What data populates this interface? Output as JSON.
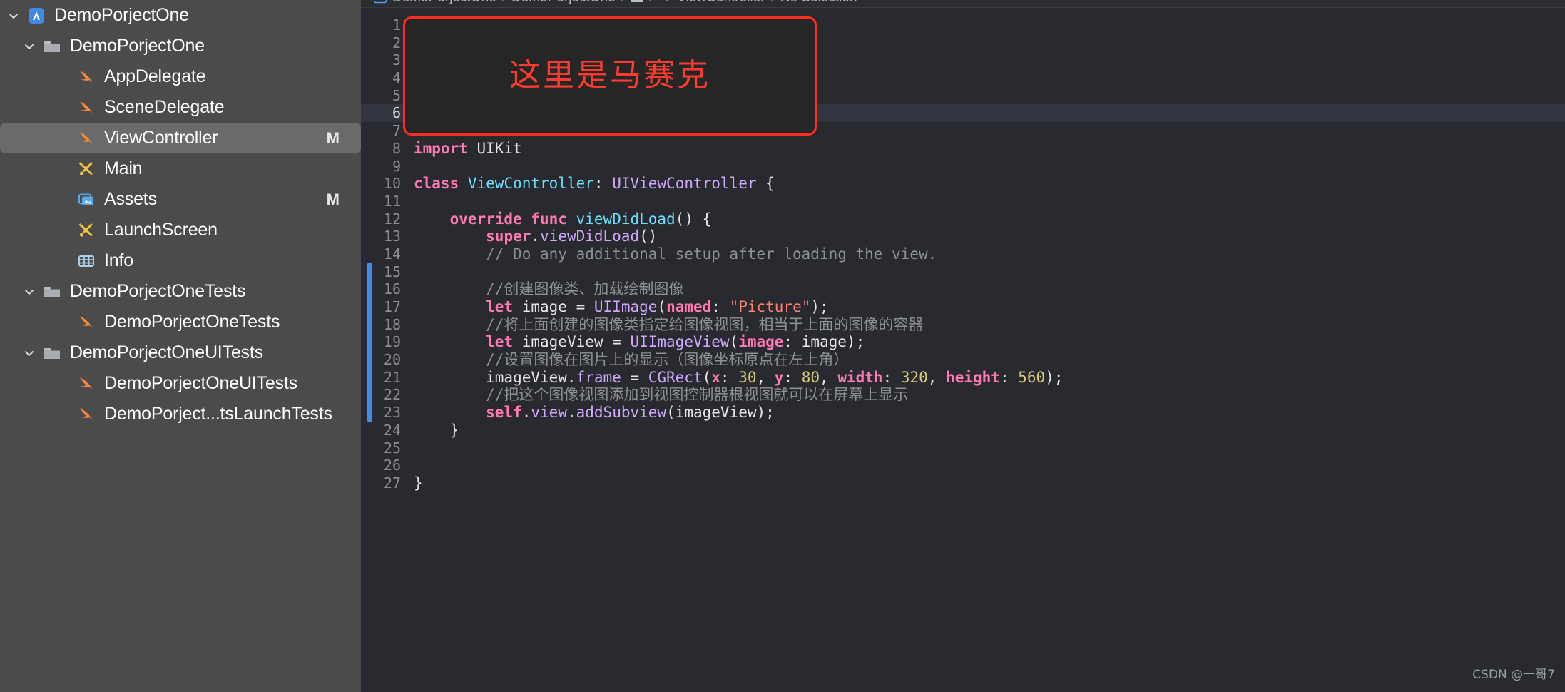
{
  "app": {
    "name": "Xcode",
    "watermark": "CSDN @一哥7"
  },
  "sidebar": {
    "items": [
      {
        "label": "DemoPorjectOne",
        "icon": "xcode-project-icon",
        "indent": 0,
        "twisty": "down",
        "badge": "",
        "selected": false
      },
      {
        "label": "DemoPorjectOne",
        "icon": "folder-icon",
        "indent": 1,
        "twisty": "down",
        "badge": "",
        "selected": false
      },
      {
        "label": "AppDelegate",
        "icon": "swift-file-icon",
        "indent": 2,
        "twisty": "",
        "badge": "",
        "selected": false
      },
      {
        "label": "SceneDelegate",
        "icon": "swift-file-icon",
        "indent": 2,
        "twisty": "",
        "badge": "",
        "selected": false
      },
      {
        "label": "ViewController",
        "icon": "swift-file-icon",
        "indent": 2,
        "twisty": "",
        "badge": "M",
        "selected": true
      },
      {
        "label": "Main",
        "icon": "storyboard-icon",
        "indent": 2,
        "twisty": "",
        "badge": "",
        "selected": false
      },
      {
        "label": "Assets",
        "icon": "assets-catalog-icon",
        "indent": 2,
        "twisty": "",
        "badge": "M",
        "selected": false
      },
      {
        "label": "LaunchScreen",
        "icon": "storyboard-icon",
        "indent": 2,
        "twisty": "",
        "badge": "",
        "selected": false
      },
      {
        "label": "Info",
        "icon": "plist-icon",
        "indent": 2,
        "twisty": "",
        "badge": "",
        "selected": false
      },
      {
        "label": "DemoPorjectOneTests",
        "icon": "folder-icon",
        "indent": 1,
        "twisty": "down",
        "badge": "",
        "selected": false
      },
      {
        "label": "DemoPorjectOneTests",
        "icon": "swift-file-icon",
        "indent": 2,
        "twisty": "",
        "badge": "",
        "selected": false
      },
      {
        "label": "DemoPorjectOneUITests",
        "icon": "folder-icon",
        "indent": 1,
        "twisty": "down",
        "badge": "",
        "selected": false
      },
      {
        "label": "DemoPorjectOneUITests",
        "icon": "swift-file-icon",
        "indent": 2,
        "twisty": "",
        "badge": "",
        "selected": false
      },
      {
        "label": "DemoPorject...tsLaunchTests",
        "icon": "swift-file-icon",
        "indent": 2,
        "twisty": "",
        "badge": "",
        "selected": false
      }
    ]
  },
  "breadcrumb": {
    "items": [
      "DemoPorjectOne",
      "DemoPorjectOne",
      "ViewController",
      "No Selection"
    ]
  },
  "redaction": {
    "text": "这里是马赛克",
    "border_color": "#ff2d1f",
    "text_color": "#ff3b2f"
  },
  "editor": {
    "current_line": 6,
    "change_bar_color": "#3c8fe8",
    "change_bar_from_line": 15,
    "change_bar_to_line": 23,
    "lines": [
      {
        "n": 1,
        "tokens": []
      },
      {
        "n": 2,
        "tokens": []
      },
      {
        "n": 3,
        "tokens": []
      },
      {
        "n": 4,
        "tokens": []
      },
      {
        "n": 5,
        "tokens": []
      },
      {
        "n": 6,
        "tokens": []
      },
      {
        "n": 7,
        "tokens": []
      },
      {
        "n": 8,
        "tokens": [
          {
            "t": "import",
            "c": "kw"
          },
          {
            "t": " UIKit",
            "c": "pln"
          }
        ]
      },
      {
        "n": 9,
        "tokens": []
      },
      {
        "n": 10,
        "tokens": [
          {
            "t": "class",
            "c": "kw"
          },
          {
            "t": " ",
            "c": "pln"
          },
          {
            "t": "ViewController",
            "c": "cls"
          },
          {
            "t": ": ",
            "c": "pln"
          },
          {
            "t": "UIViewController",
            "c": "type"
          },
          {
            "t": " {",
            "c": "pln"
          }
        ]
      },
      {
        "n": 11,
        "tokens": []
      },
      {
        "n": 12,
        "tokens": [
          {
            "t": "    ",
            "c": "pln"
          },
          {
            "t": "override",
            "c": "kw"
          },
          {
            "t": " ",
            "c": "pln"
          },
          {
            "t": "func",
            "c": "kw"
          },
          {
            "t": " ",
            "c": "pln"
          },
          {
            "t": "viewDidLoad",
            "c": "fn"
          },
          {
            "t": "() {",
            "c": "pln"
          }
        ]
      },
      {
        "n": 13,
        "tokens": [
          {
            "t": "        ",
            "c": "pln"
          },
          {
            "t": "super",
            "c": "kw"
          },
          {
            "t": ".",
            "c": "pln"
          },
          {
            "t": "viewDidLoad",
            "c": "prop"
          },
          {
            "t": "()",
            "c": "pln"
          }
        ]
      },
      {
        "n": 14,
        "tokens": [
          {
            "t": "        // Do any additional setup after loading the view.",
            "c": "cmt"
          }
        ]
      },
      {
        "n": 15,
        "tokens": []
      },
      {
        "n": 16,
        "tokens": [
          {
            "t": "        //创建图像类、加载绘制图像",
            "c": "cmt"
          }
        ]
      },
      {
        "n": 17,
        "tokens": [
          {
            "t": "        ",
            "c": "pln"
          },
          {
            "t": "let",
            "c": "kw"
          },
          {
            "t": " image = ",
            "c": "pln"
          },
          {
            "t": "UIImage",
            "c": "type"
          },
          {
            "t": "(",
            "c": "pln"
          },
          {
            "t": "named",
            "c": "kw"
          },
          {
            "t": ": ",
            "c": "pln"
          },
          {
            "t": "\"Picture\"",
            "c": "str"
          },
          {
            "t": ");",
            "c": "pln"
          }
        ]
      },
      {
        "n": 18,
        "tokens": [
          {
            "t": "        //将上面创建的图像类指定给图像视图，相当于上面的图像的容器",
            "c": "cmt"
          }
        ]
      },
      {
        "n": 19,
        "tokens": [
          {
            "t": "        ",
            "c": "pln"
          },
          {
            "t": "let",
            "c": "kw"
          },
          {
            "t": " imageView = ",
            "c": "pln"
          },
          {
            "t": "UIImageView",
            "c": "type"
          },
          {
            "t": "(",
            "c": "pln"
          },
          {
            "t": "image",
            "c": "kw"
          },
          {
            "t": ": image);",
            "c": "pln"
          }
        ]
      },
      {
        "n": 20,
        "tokens": [
          {
            "t": "        //设置图像在图片上的显示（图像坐标原点在左上角）",
            "c": "cmt"
          }
        ]
      },
      {
        "n": 21,
        "tokens": [
          {
            "t": "        imageView.",
            "c": "pln"
          },
          {
            "t": "frame",
            "c": "prop"
          },
          {
            "t": " = ",
            "c": "pln"
          },
          {
            "t": "CGRect",
            "c": "type"
          },
          {
            "t": "(",
            "c": "pln"
          },
          {
            "t": "x",
            "c": "kw"
          },
          {
            "t": ": ",
            "c": "pln"
          },
          {
            "t": "30",
            "c": "num"
          },
          {
            "t": ", ",
            "c": "pln"
          },
          {
            "t": "y",
            "c": "kw"
          },
          {
            "t": ": ",
            "c": "pln"
          },
          {
            "t": "80",
            "c": "num"
          },
          {
            "t": ", ",
            "c": "pln"
          },
          {
            "t": "width",
            "c": "kw"
          },
          {
            "t": ": ",
            "c": "pln"
          },
          {
            "t": "320",
            "c": "num"
          },
          {
            "t": ", ",
            "c": "pln"
          },
          {
            "t": "height",
            "c": "kw"
          },
          {
            "t": ": ",
            "c": "pln"
          },
          {
            "t": "560",
            "c": "num"
          },
          {
            "t": ");",
            "c": "pln"
          }
        ]
      },
      {
        "n": 22,
        "tokens": [
          {
            "t": "        //把这个图像视图添加到视图控制器根视图就可以在屏幕上显示",
            "c": "cmt"
          }
        ]
      },
      {
        "n": 23,
        "tokens": [
          {
            "t": "        ",
            "c": "pln"
          },
          {
            "t": "self",
            "c": "kw"
          },
          {
            "t": ".",
            "c": "pln"
          },
          {
            "t": "view",
            "c": "prop"
          },
          {
            "t": ".",
            "c": "pln"
          },
          {
            "t": "addSubview",
            "c": "prop"
          },
          {
            "t": "(imageView);",
            "c": "pln"
          }
        ]
      },
      {
        "n": 24,
        "tokens": [
          {
            "t": "    }",
            "c": "pln"
          }
        ]
      },
      {
        "n": 25,
        "tokens": []
      },
      {
        "n": 26,
        "tokens": []
      },
      {
        "n": 27,
        "tokens": [
          {
            "t": "}",
            "c": "pln"
          }
        ]
      }
    ]
  }
}
